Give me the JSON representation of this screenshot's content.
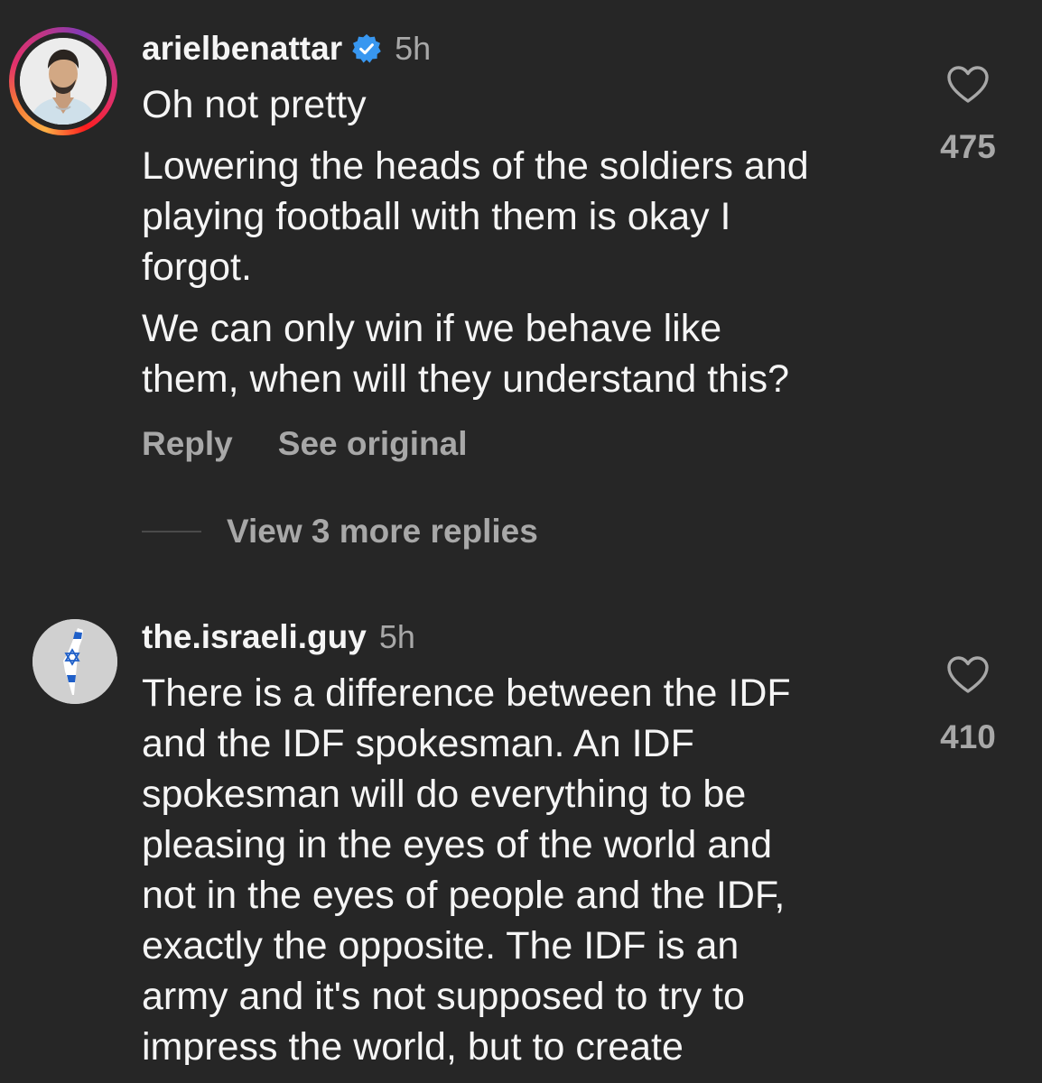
{
  "colors": {
    "background": "#262626",
    "primary_text": "#f5f5f5",
    "secondary_text": "#a8a8a8",
    "verified_blue": "#3897f0"
  },
  "comments": [
    {
      "username": "arielbenattar",
      "verified": true,
      "time": "5h",
      "lines": [
        "Oh not pretty",
        "Lowering the heads of the soldiers and",
        "playing football with them is okay I",
        "forgot.",
        "We can only win if we behave like",
        "them, when will they understand this?"
      ],
      "like_count": "475",
      "actions": {
        "reply": "Reply",
        "see_original": "See original"
      },
      "view_replies": "View 3 more replies",
      "avatar_icon": "profile-photo"
    },
    {
      "username": "the.israeli.guy",
      "verified": false,
      "time": "5h",
      "lines": [
        "There is a difference between the IDF",
        "and the IDF spokesman. An IDF",
        "spokesman will do everything to be",
        "pleasing in the eyes of the world and",
        "not in the eyes of people and the IDF,",
        "exactly the opposite. The IDF is an",
        "army and it's not supposed to try to",
        "impress the world, but to create"
      ],
      "like_count": "410",
      "avatar_icon": "israel-map-flag"
    }
  ]
}
